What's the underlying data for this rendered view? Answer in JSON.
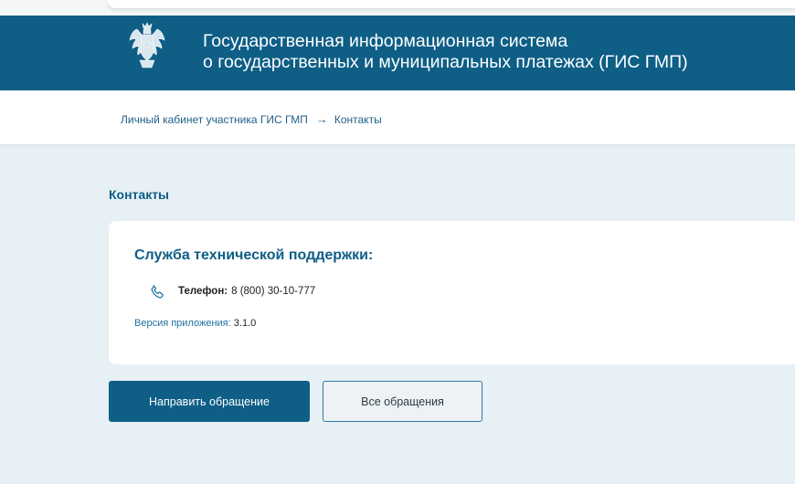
{
  "header": {
    "title_line1": "Государственная информационная система",
    "title_line2": "о государственных и муниципальных платежах (ГИС ГМП)",
    "emblem_icon": "coat-of-arms-icon"
  },
  "breadcrumb": {
    "parent": "Личный кабинет участника ГИС ГМП",
    "separator": "→",
    "current": "Контакты"
  },
  "page": {
    "title": "Контакты"
  },
  "support": {
    "title": "Служба технической поддержки:",
    "phone_icon": "phone-icon",
    "phone_label": "Телефон:",
    "phone_value": "8 (800) 30-10-777",
    "version_label": "Версия приложения:",
    "version_value": "3.1.0"
  },
  "actions": {
    "submit_label": "Направить обращение",
    "all_label": "Все обращения"
  },
  "colors": {
    "brand": "#0e5e86",
    "background": "#e7f0f5",
    "card": "#ffffff",
    "secondary_button": "#eef2f4"
  }
}
